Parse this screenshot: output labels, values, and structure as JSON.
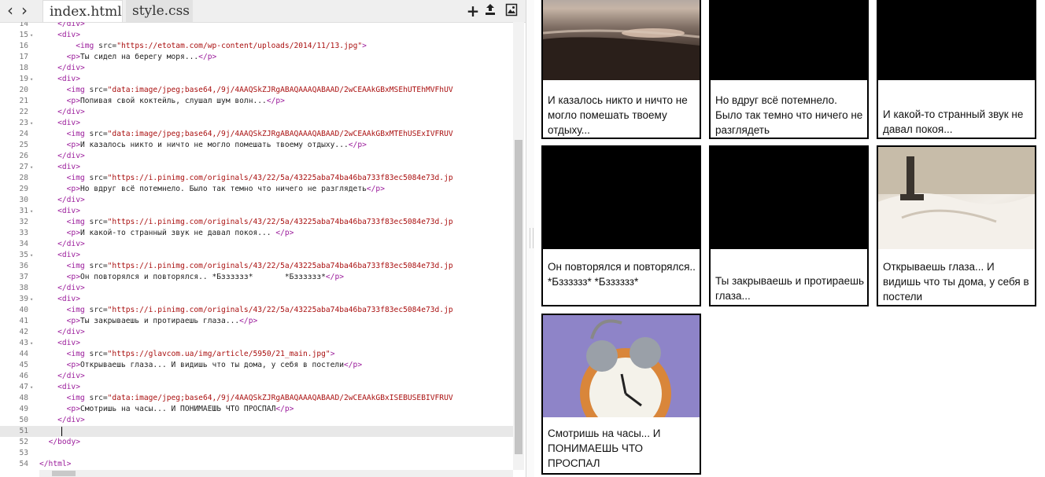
{
  "editor": {
    "tabs": [
      "index.html",
      "style.css"
    ],
    "lines": [
      {
        "n": "14",
        "fold": false,
        "html": "<span class=\"tag\">&lt;/div&gt;</span>",
        "indent": "    "
      },
      {
        "n": "15",
        "fold": true,
        "html": "<span class=\"tag\">&lt;div&gt;</span>",
        "indent": "    "
      },
      {
        "n": "16",
        "fold": false,
        "html": "<span class=\"tag\">&lt;img</span> <span class=\"attr\">src=</span><span class=\"str\">\"https://etotam.com/wp-content/uploads/2014/11/13.jpg\"</span><span class=\"tag\">&gt;</span>",
        "indent": "        "
      },
      {
        "n": "17",
        "fold": false,
        "html": "<span class=\"tag\">&lt;p&gt;</span><span class=\"txt\">Ты сидел на берегу моря...</span><span class=\"tag\">&lt;/p&gt;</span>",
        "indent": "      "
      },
      {
        "n": "18",
        "fold": false,
        "html": "<span class=\"tag\">&lt;/div&gt;</span>",
        "indent": "    "
      },
      {
        "n": "19",
        "fold": true,
        "html": "<span class=\"tag\">&lt;div&gt;</span>",
        "indent": "    "
      },
      {
        "n": "20",
        "fold": false,
        "html": "<span class=\"tag\">&lt;img</span> <span class=\"attr\">src=</span><span class=\"str\">\"data:image/jpeg;base64,/9j/4AAQSkZJRgABAQAAAQABAAD/2wCEAAkGBxMSEhUTEhMVFhUV</span>",
        "indent": "      "
      },
      {
        "n": "21",
        "fold": false,
        "html": "<span class=\"tag\">&lt;p&gt;</span><span class=\"txt\">Попивая свой коктейль, слушал шум волн...</span><span class=\"tag\">&lt;/p&gt;</span>",
        "indent": "      "
      },
      {
        "n": "22",
        "fold": false,
        "html": "<span class=\"tag\">&lt;/div&gt;</span>",
        "indent": "    "
      },
      {
        "n": "23",
        "fold": true,
        "html": "<span class=\"tag\">&lt;div&gt;</span>",
        "indent": "    "
      },
      {
        "n": "24",
        "fold": false,
        "html": "<span class=\"tag\">&lt;img</span> <span class=\"attr\">src=</span><span class=\"str\">\"data:image/jpeg;base64,/9j/4AAQSkZJRgABAQAAAQABAAD/2wCEAAkGBxMTEhUSExIVFRUV</span>",
        "indent": "      "
      },
      {
        "n": "25",
        "fold": false,
        "html": "<span class=\"tag\">&lt;p&gt;</span><span class=\"txt\">И казалось никто и ничто не могло помешать твоему отдыху...</span><span class=\"tag\">&lt;/p&gt;</span>",
        "indent": "      "
      },
      {
        "n": "26",
        "fold": false,
        "html": "<span class=\"tag\">&lt;/div&gt;</span>",
        "indent": "    "
      },
      {
        "n": "27",
        "fold": true,
        "html": "<span class=\"tag\">&lt;div&gt;</span>",
        "indent": "    "
      },
      {
        "n": "28",
        "fold": false,
        "html": "<span class=\"tag\">&lt;img</span> <span class=\"attr\">src=</span><span class=\"str\">\"https://i.pinimg.com/originals/43/22/5a/43225aba74ba46ba733f83ec5084e73d.jp</span>",
        "indent": "      "
      },
      {
        "n": "29",
        "fold": false,
        "html": "<span class=\"tag\">&lt;p&gt;</span><span class=\"txt\">Но вдруг всё потемнело. Было так темно что ничего не разглядеть</span><span class=\"tag\">&lt;/p&gt;</span>",
        "indent": "      "
      },
      {
        "n": "30",
        "fold": false,
        "html": "<span class=\"tag\">&lt;/div&gt;</span>",
        "indent": "    "
      },
      {
        "n": "31",
        "fold": true,
        "html": "<span class=\"tag\">&lt;div&gt;</span>",
        "indent": "    "
      },
      {
        "n": "32",
        "fold": false,
        "html": "<span class=\"tag\">&lt;img</span> <span class=\"attr\">src=</span><span class=\"str\">\"https://i.pinimg.com/originals/43/22/5a/43225aba74ba46ba733f83ec5084e73d.jp</span>",
        "indent": "      "
      },
      {
        "n": "33",
        "fold": false,
        "html": "<span class=\"tag\">&lt;p&gt;</span><span class=\"txt\">И какой-то странный звук не давал покоя... </span><span class=\"tag\">&lt;/p&gt;</span>",
        "indent": "      "
      },
      {
        "n": "34",
        "fold": false,
        "html": "<span class=\"tag\">&lt;/div&gt;</span>",
        "indent": "    "
      },
      {
        "n": "35",
        "fold": true,
        "html": "<span class=\"tag\">&lt;div&gt;</span>",
        "indent": "    "
      },
      {
        "n": "36",
        "fold": false,
        "html": "<span class=\"tag\">&lt;img</span> <span class=\"attr\">src=</span><span class=\"str\">\"https://i.pinimg.com/originals/43/22/5a/43225aba74ba46ba733f83ec5084e73d.jp</span>",
        "indent": "      "
      },
      {
        "n": "37",
        "fold": false,
        "html": "<span class=\"tag\">&lt;p&gt;</span><span class=\"txt\">Он повторялся и повторялся.. *Бзззззз*       *Бзззззз*</span><span class=\"tag\">&lt;/p&gt;</span>",
        "indent": "      "
      },
      {
        "n": "38",
        "fold": false,
        "html": "<span class=\"tag\">&lt;/div&gt;</span>",
        "indent": "    "
      },
      {
        "n": "39",
        "fold": true,
        "html": "<span class=\"tag\">&lt;div&gt;</span>",
        "indent": "    "
      },
      {
        "n": "40",
        "fold": false,
        "html": "<span class=\"tag\">&lt;img</span> <span class=\"attr\">src=</span><span class=\"str\">\"https://i.pinimg.com/originals/43/22/5a/43225aba74ba46ba733f83ec5084e73d.jp</span>",
        "indent": "      "
      },
      {
        "n": "41",
        "fold": false,
        "html": "<span class=\"tag\">&lt;p&gt;</span><span class=\"txt\">Ты закрываешь и протираешь глаза...</span><span class=\"tag\">&lt;/p&gt;</span>",
        "indent": "      "
      },
      {
        "n": "42",
        "fold": false,
        "html": "<span class=\"tag\">&lt;/div&gt;</span>",
        "indent": "    "
      },
      {
        "n": "43",
        "fold": true,
        "html": "<span class=\"tag\">&lt;div&gt;</span>",
        "indent": "    "
      },
      {
        "n": "44",
        "fold": false,
        "html": "<span class=\"tag\">&lt;img</span> <span class=\"attr\">src=</span><span class=\"str\">\"https://glavcom.ua/img/article/5950/21_main.jpg\"</span><span class=\"tag\">&gt;</span>",
        "indent": "      "
      },
      {
        "n": "45",
        "fold": false,
        "html": "<span class=\"tag\">&lt;p&gt;</span><span class=\"txt\">Открываешь глаза... И видишь что ты дома, у себя в постели</span><span class=\"tag\">&lt;/p&gt;</span>",
        "indent": "      "
      },
      {
        "n": "46",
        "fold": false,
        "html": "<span class=\"tag\">&lt;/div&gt;</span>",
        "indent": "    "
      },
      {
        "n": "47",
        "fold": true,
        "html": "<span class=\"tag\">&lt;div&gt;</span>",
        "indent": "    "
      },
      {
        "n": "48",
        "fold": false,
        "html": "<span class=\"tag\">&lt;img</span> <span class=\"attr\">src=</span><span class=\"str\">\"data:image/jpeg;base64,/9j/4AAQSkZJRgABAQAAAQABAAD/2wCEAAkGBxISEBUSEBIVFRUV</span>",
        "indent": "      "
      },
      {
        "n": "49",
        "fold": false,
        "html": "<span class=\"tag\">&lt;p&gt;</span><span class=\"txt\">Смотришь на часы... И ПОНИМАЕШЬ ЧТО ПРОСПАЛ</span><span class=\"tag\">&lt;/p&gt;</span>",
        "indent": "      "
      },
      {
        "n": "50",
        "fold": false,
        "html": "<span class=\"tag\">&lt;/div&gt;</span>",
        "indent": "    "
      },
      {
        "n": "51",
        "fold": false,
        "html": "",
        "indent": "",
        "active": true
      },
      {
        "n": "52",
        "fold": false,
        "html": "<span class=\"tag\">&lt;/body&gt;</span>",
        "indent": "  "
      },
      {
        "n": "53",
        "fold": false,
        "html": "",
        "indent": ""
      },
      {
        "n": "54",
        "fold": false,
        "html": "<span class=\"tag\">&lt;/html&gt;</span>",
        "indent": ""
      }
    ]
  },
  "preview": {
    "cards": [
      {
        "caption": "И казалось никто и ничто не могло помешать твоему отдыху...",
        "image": "sea-photo"
      },
      {
        "caption": "Но вдруг всё потемнело. Было так темно что ничего не разглядеть",
        "image": "black"
      },
      {
        "caption": "И какой-то странный звук не давал покоя...",
        "image": "black"
      },
      {
        "caption": "Он повторялся и повторялся.. *Бзззззз* *Бзззззз*",
        "image": "black"
      },
      {
        "caption": "Ты закрываешь и протираешь глаза...",
        "image": "black"
      },
      {
        "caption": "Открываешь глаза... И видишь что ты дома, у себя в постели",
        "image": "bed-photo"
      },
      {
        "caption": "Смотришь на часы... И ПОНИМАЕШЬ ЧТО ПРОСПАЛ",
        "image": "alarm-clock-photo"
      }
    ]
  }
}
